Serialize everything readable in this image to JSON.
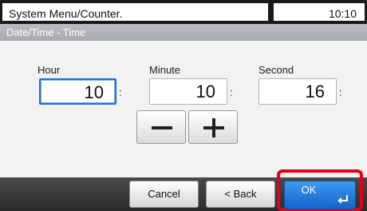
{
  "header": {
    "title": "System Menu/Counter.",
    "clock": "10:10"
  },
  "subheader": {
    "title": "Date/Time - Time"
  },
  "fields": {
    "hour": {
      "label": "Hour",
      "value": "10",
      "separator": ":"
    },
    "minute": {
      "label": "Minute",
      "value": "10",
      "separator": ":"
    },
    "second": {
      "label": "Second",
      "value": "16",
      "separator": ":"
    }
  },
  "stepper": {
    "decrement_icon": "minus-icon",
    "increment_icon": "plus-icon"
  },
  "footer": {
    "cancel_label": "Cancel",
    "back_label": "< Back",
    "ok_label": "OK",
    "ok_icon": "enter-icon"
  },
  "colors": {
    "ok_button": "#1f6fd4",
    "highlight": "#e2001a",
    "active_field": "#1f6fd4"
  }
}
